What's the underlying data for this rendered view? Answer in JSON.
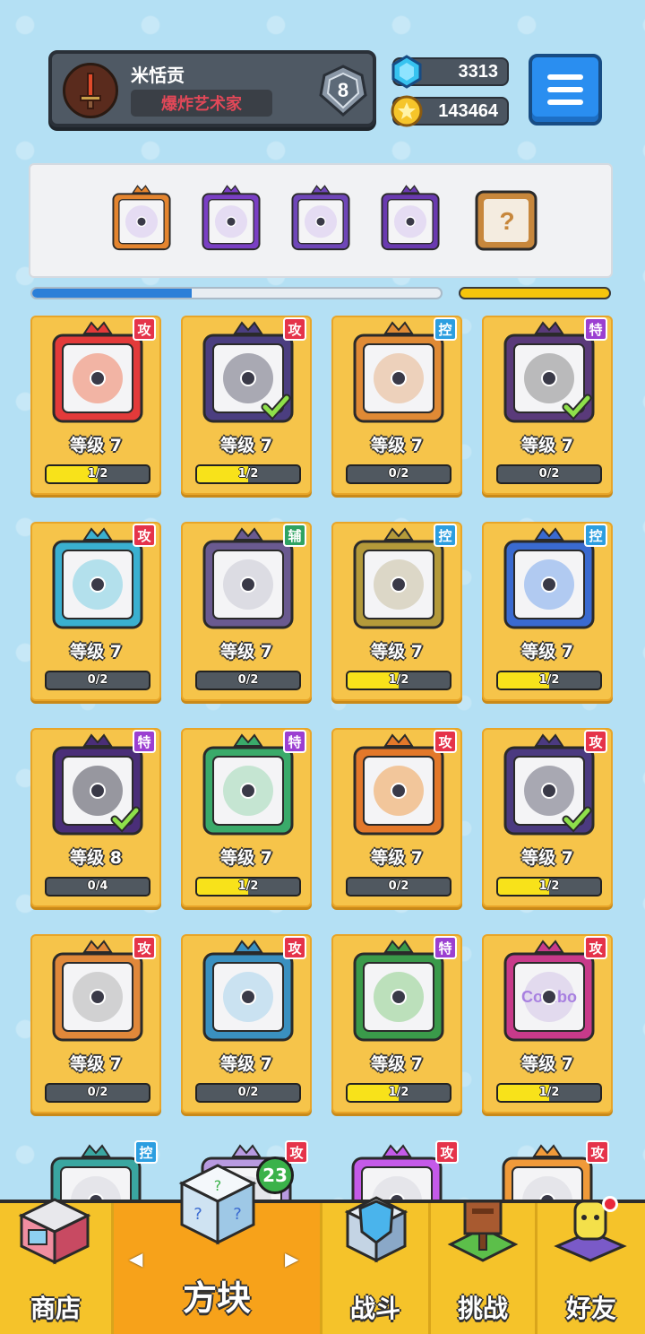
{
  "player": {
    "name": "米恬贡",
    "title": "爆炸艺术家",
    "rank": "8"
  },
  "currency": {
    "gems": "3313",
    "coins": "143464"
  },
  "colors": {
    "attack": "#e5334a",
    "control": "#2c9ee0",
    "special": "#9b3fd1",
    "support": "#2fa362"
  },
  "deck": [
    {
      "icon": "rainbow-infinity-block-icon",
      "frame": "#e4852f"
    },
    {
      "icon": "purple-rune-block-icon",
      "frame": "#7a3fc4"
    },
    {
      "icon": "violet-rune-block-icon",
      "frame": "#6f46b8"
    },
    {
      "icon": "lavender-rune-block-icon",
      "frame": "#6a3ab0"
    },
    {
      "icon": "random-block-icon",
      "frame": "#c7873c"
    }
  ],
  "deck_progress": 0.39,
  "cards": [
    {
      "tag": "攻",
      "type": "attack",
      "level": "等级 7",
      "progress": "1/2",
      "fill": 0.5,
      "frame": "#e33a3a",
      "art": "#f08060",
      "check": false
    },
    {
      "tag": "攻",
      "type": "attack",
      "level": "等级 7",
      "progress": "1/2",
      "fill": 0.5,
      "frame": "#4b3e80",
      "art": "#6c6c7c",
      "check": true
    },
    {
      "tag": "控",
      "type": "control",
      "level": "等级 7",
      "progress": "0/2",
      "fill": 0,
      "frame": "#e08a35",
      "art": "#e8b48a",
      "check": false
    },
    {
      "tag": "特",
      "type": "special",
      "level": "等级 7",
      "progress": "0/2",
      "fill": 0,
      "frame": "#5a3a7a",
      "art": "#8a8a8a",
      "check": true
    },
    {
      "tag": "攻",
      "type": "attack",
      "level": "等级 7",
      "progress": "0/2",
      "fill": 0,
      "frame": "#3ab0d0",
      "art": "#7dd0e4",
      "check": false
    },
    {
      "tag": "辅",
      "type": "support",
      "level": "等级 7",
      "progress": "0/2",
      "fill": 0,
      "frame": "#6a5a90",
      "art": "#c8c8d4",
      "check": false
    },
    {
      "tag": "控",
      "type": "control",
      "level": "等级 7",
      "progress": "1/2",
      "fill": 0.5,
      "frame": "#b49a3a",
      "art": "#c8c0a0",
      "check": false
    },
    {
      "tag": "控",
      "type": "control",
      "level": "等级 7",
      "progress": "1/2",
      "fill": 0.5,
      "frame": "#3a6ad0",
      "art": "#7aa8ec",
      "check": false
    },
    {
      "tag": "特",
      "type": "special",
      "level": "等级 8",
      "progress": "0/4",
      "fill": 0,
      "frame": "#4a2e78",
      "art": "#4a4a58",
      "check": true
    },
    {
      "tag": "特",
      "type": "special",
      "level": "等级 7",
      "progress": "1/2",
      "fill": 0.5,
      "frame": "#3aaa6a",
      "art": "#9ed8b4",
      "check": false
    },
    {
      "tag": "攻",
      "type": "attack",
      "level": "等级 7",
      "progress": "0/2",
      "fill": 0,
      "frame": "#e3782a",
      "art": "#f0a050",
      "check": false
    },
    {
      "tag": "攻",
      "type": "attack",
      "level": "等级 7",
      "progress": "1/2",
      "fill": 0.5,
      "frame": "#4b3a80",
      "art": "#6a6a7a",
      "check": true
    },
    {
      "tag": "攻",
      "type": "attack",
      "level": "等级 7",
      "progress": "0/2",
      "fill": 0,
      "frame": "#e0883a",
      "art": "#b4b4b4",
      "check": false
    },
    {
      "tag": "攻",
      "type": "attack",
      "level": "等级 7",
      "progress": "0/2",
      "fill": 0,
      "frame": "#3a90c0",
      "art": "#a8d4ec",
      "check": false
    },
    {
      "tag": "特",
      "type": "special",
      "level": "等级 7",
      "progress": "1/2",
      "fill": 0.5,
      "frame": "#3a9a4a",
      "art": "#8ed08a",
      "check": false
    },
    {
      "tag": "攻",
      "type": "attack",
      "level": "等级 7",
      "progress": "1/2",
      "fill": 0.5,
      "frame": "#c83a8a",
      "art": "#d4c4e8",
      "check": false,
      "label": "Combo"
    }
  ],
  "partial_cards": [
    {
      "tag": "控",
      "type": "control",
      "frame": "#3aa6a0"
    },
    {
      "tag": "攻",
      "type": "attack",
      "frame": "#b89ae0"
    },
    {
      "tag": "攻",
      "type": "attack",
      "frame": "#c45ae8"
    },
    {
      "tag": "攻",
      "type": "attack",
      "frame": "#f09a3a"
    }
  ],
  "nav": {
    "shop": "商店",
    "blocks": "方块",
    "blocks_count": "23",
    "battle": "战斗",
    "challenge": "挑战",
    "friends": "好友"
  }
}
